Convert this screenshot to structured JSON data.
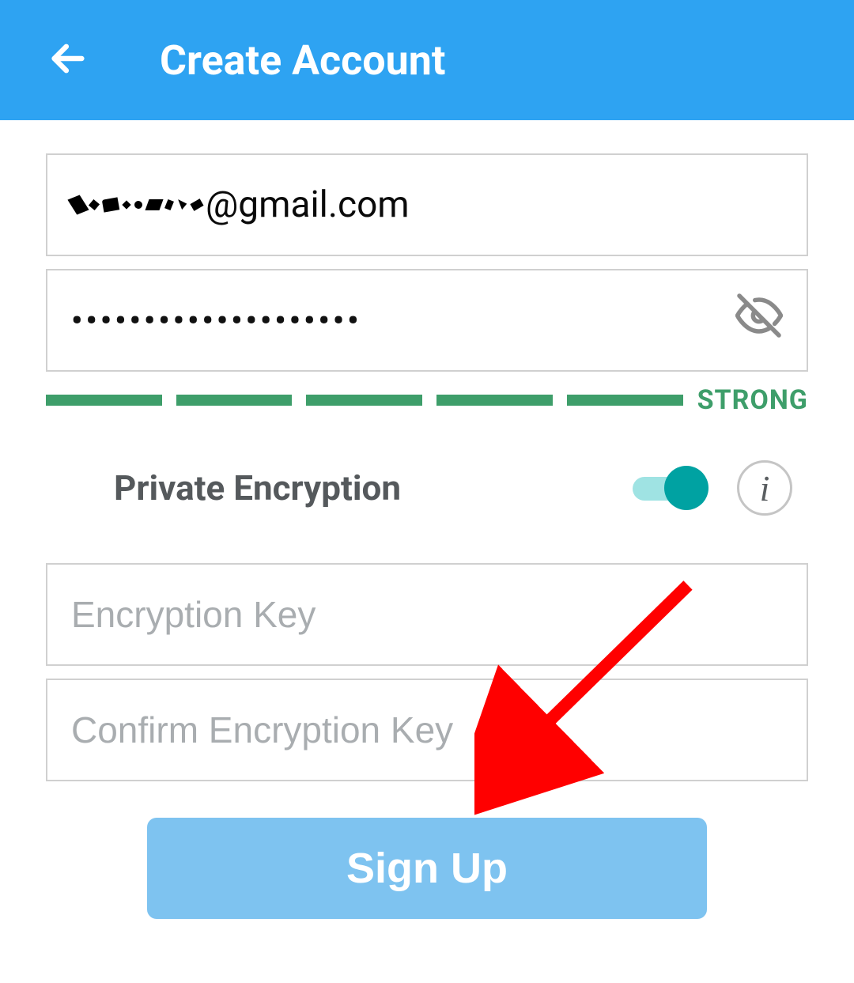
{
  "header": {
    "title": "Create Account"
  },
  "form": {
    "email_domain": "@gmail.com",
    "password_mask": "••••••••••••••••••••",
    "strength_label": "STRONG",
    "strength_color": "#3e9e6a",
    "strength_segments": 5,
    "encryption_label": "Private Encryption",
    "encryption_enabled": true,
    "encryption_key_placeholder": "Encryption Key",
    "confirm_key_placeholder": "Confirm Encryption Key",
    "signup_label": "Sign Up"
  },
  "annotation": {
    "arrow_color": "#ff0000"
  }
}
